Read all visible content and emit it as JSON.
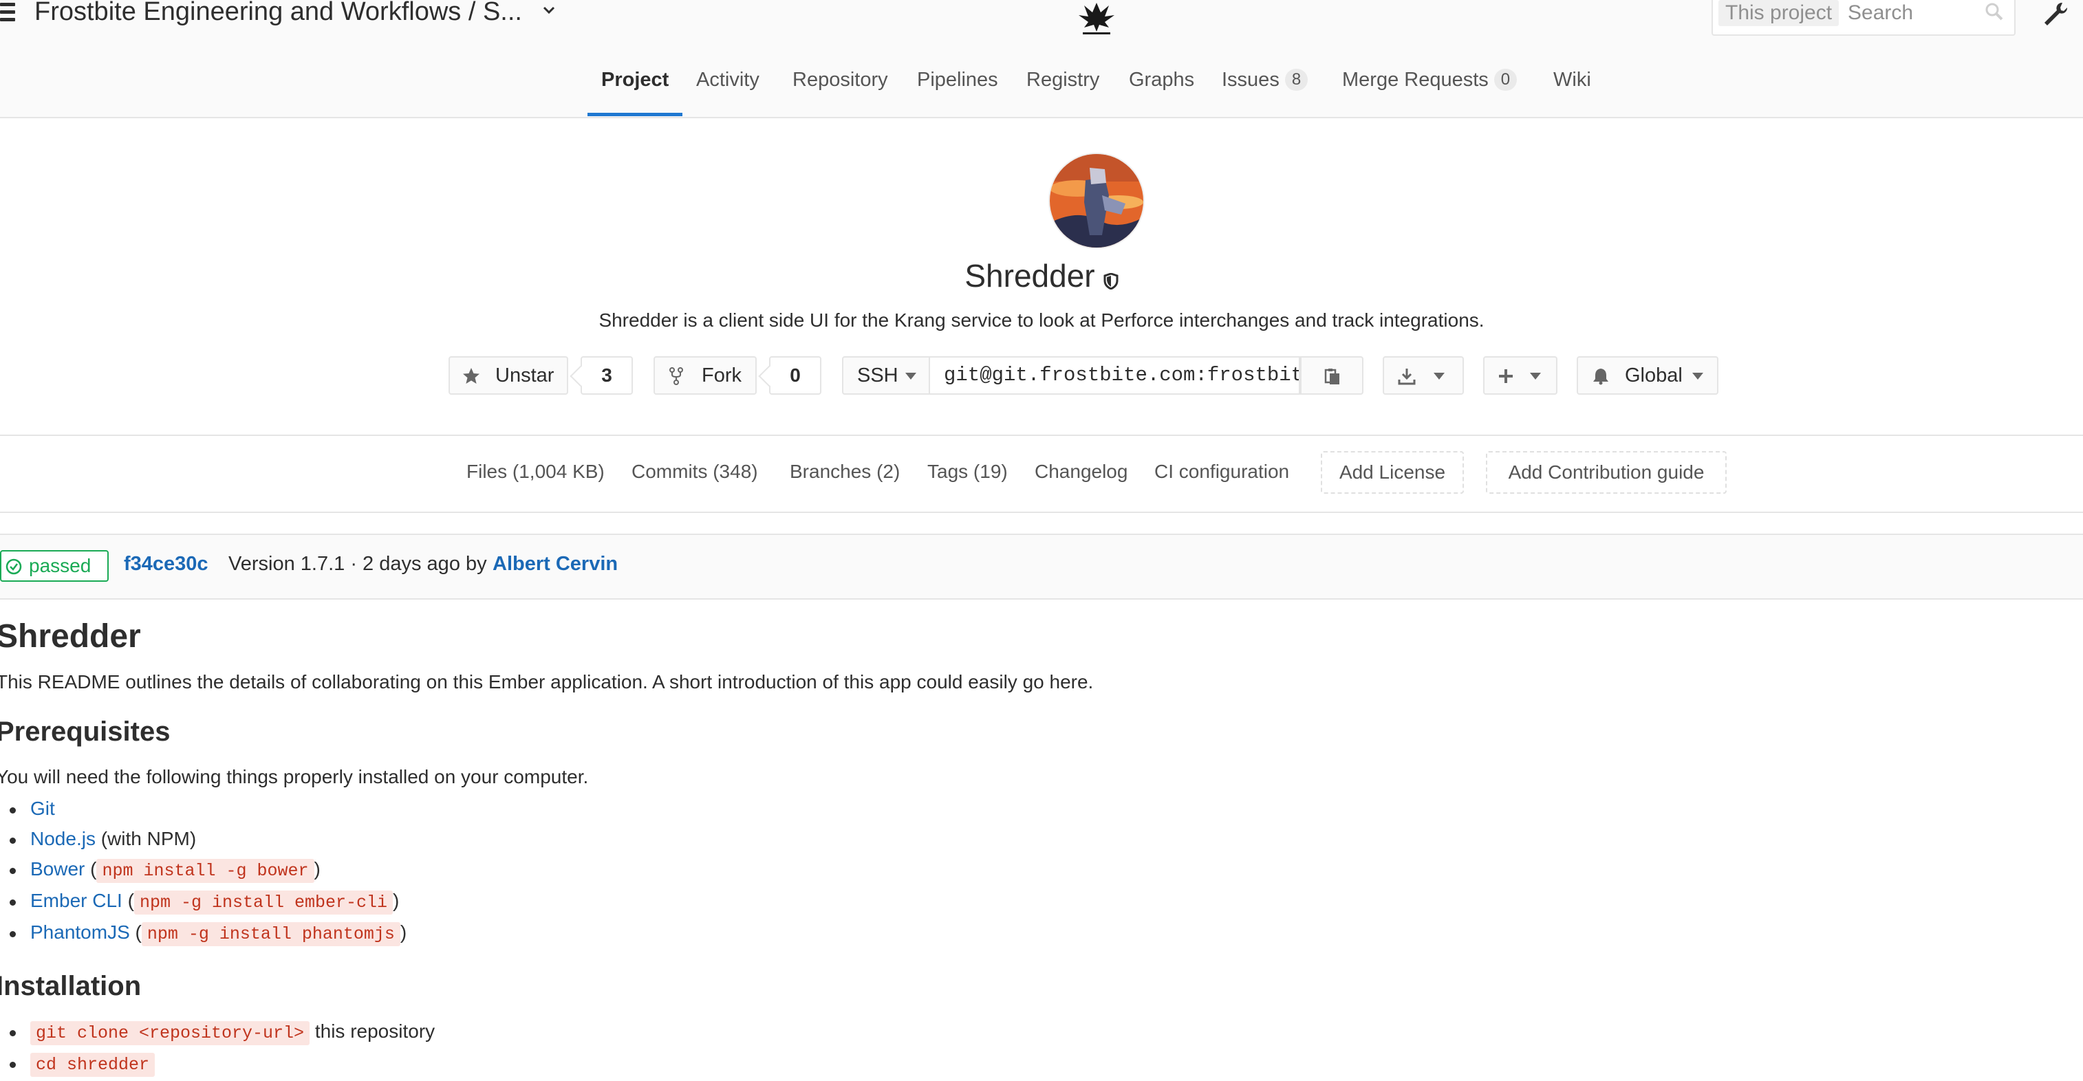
{
  "header": {
    "group_title": "Frostbite Engineering and Workflows / S...",
    "search_scope": "This project",
    "search_placeholder": "Search"
  },
  "nav": {
    "tabs": [
      {
        "label": "Project",
        "active": true
      },
      {
        "label": "Activity"
      },
      {
        "label": "Repository"
      },
      {
        "label": "Pipelines"
      },
      {
        "label": "Registry"
      },
      {
        "label": "Graphs"
      },
      {
        "label": "Issues",
        "badge": "8"
      },
      {
        "label": "Merge Requests",
        "badge": "0"
      },
      {
        "label": "Wiki"
      }
    ]
  },
  "project": {
    "name": "Shredder",
    "description": "Shredder is a client side UI for the Krang service to look at Perforce interchanges and track integrations.",
    "star_label": "Unstar",
    "star_count": "3",
    "fork_label": "Fork",
    "fork_count": "0",
    "protocol": "SSH",
    "clone_url": "git@git.frostbite.com:frostbit",
    "notification_level": "Global"
  },
  "stats": {
    "files": "Files (1,004 KB)",
    "commits": "Commits (348)",
    "branches": "Branches (2)",
    "tags": "Tags (19)",
    "changelog": "Changelog",
    "ci": "CI configuration",
    "add_license": "Add License",
    "add_contribution": "Add Contribution guide"
  },
  "last_commit": {
    "status": "passed",
    "sha": "f34ce30c",
    "message": "Version 1.7.1 · 2 days ago by",
    "author": "Albert Cervin"
  },
  "readme": {
    "title": "Shredder",
    "intro": "This README outlines the details of collaborating on this Ember application. A short introduction of this app could easily go here.",
    "prereq_heading": "Prerequisites",
    "prereq_intro": "You will need the following things properly installed on your computer.",
    "prereqs": [
      {
        "link": "Git"
      },
      {
        "link": "Node.js",
        "suffix": " (with NPM)"
      },
      {
        "link": "Bower",
        "open": " (",
        "code": "npm install -g bower",
        "close": ")"
      },
      {
        "link": "Ember CLI",
        "open": " (",
        "code": "npm -g install ember-cli",
        "close": ")"
      },
      {
        "link": "PhantomJS",
        "open": " (",
        "code": "npm -g install phantomjs",
        "close": ")"
      }
    ],
    "install_heading": "Installation",
    "install_steps": [
      {
        "code": "git clone <repository-url>",
        "suffix": " this repository"
      },
      {
        "code": "cd shredder"
      }
    ]
  },
  "colors": {
    "link": "#1b69b6",
    "accent": "#1f78d1",
    "success": "#1aaa55",
    "code": "#c0341d"
  }
}
